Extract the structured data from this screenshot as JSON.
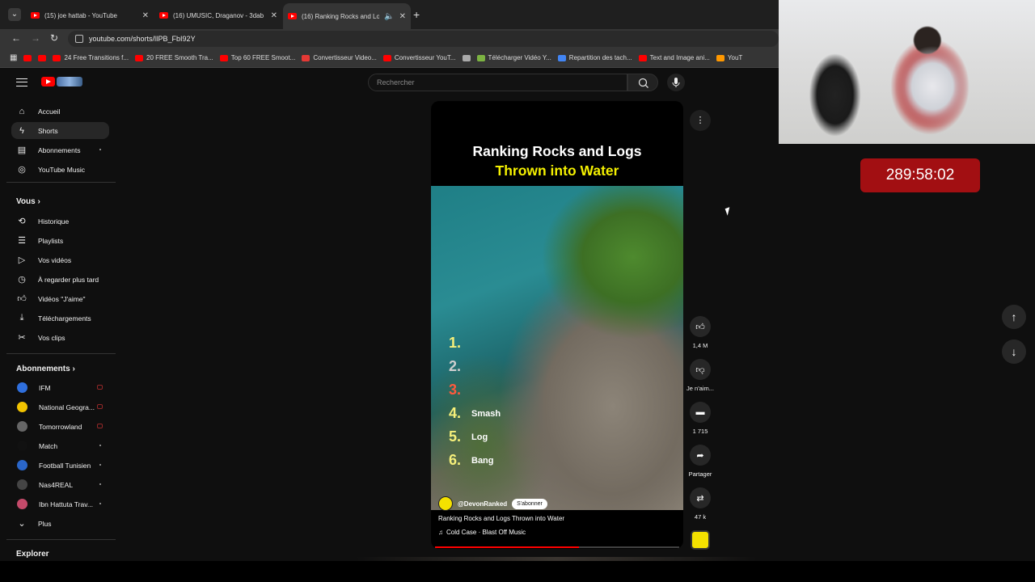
{
  "browser": {
    "tabs": [
      {
        "title": "(15) joe hattab - YouTube",
        "active": false
      },
      {
        "title": "(16) UMUSIC, Draganov - 3dab",
        "active": false
      },
      {
        "title": "(16) Ranking Rocks and Log",
        "active": true
      }
    ],
    "url": "youtube.com/shorts/lIPB_FbI92Y",
    "bookmarks": [
      {
        "label": "",
        "icon": "youtube-icon",
        "color": "#ff0000"
      },
      {
        "label": "",
        "icon": "youtube-icon",
        "color": "#ff0000"
      },
      {
        "label": "24 Free Transitions f...",
        "icon": "youtube-icon",
        "color": "#ff0000"
      },
      {
        "label": "20 FREE Smooth Tra...",
        "icon": "youtube-icon",
        "color": "#ff0000"
      },
      {
        "label": "Top 60 FREE Smoot...",
        "icon": "youtube-icon",
        "color": "#ff0000"
      },
      {
        "label": "Convertisseur Video...",
        "icon": "z-icon",
        "color": "#e53935"
      },
      {
        "label": "Convertisseur YouT...",
        "icon": "youtube-icon",
        "color": "#ff0000"
      },
      {
        "label": "",
        "icon": "globe-icon",
        "color": "#aaaaaa"
      },
      {
        "label": "Télécharger Vidéo Y...",
        "icon": "download-icon",
        "color": "#7cb342"
      },
      {
        "label": "Repartition des tach...",
        "icon": "docs-icon",
        "color": "#4285f4"
      },
      {
        "label": "Text and Image ani...",
        "icon": "youtube-icon",
        "color": "#ff0000"
      },
      {
        "label": "YouT",
        "icon": "hash-icon",
        "color": "#ff9800"
      }
    ]
  },
  "sidebar": {
    "main": [
      {
        "label": "Accueil",
        "icon": "home-icon"
      },
      {
        "label": "Shorts",
        "icon": "shorts-icon",
        "active": true
      },
      {
        "label": "Abonnements",
        "icon": "subscriptions-icon",
        "dot": true
      },
      {
        "label": "YouTube Music",
        "icon": "music-icon"
      }
    ],
    "you_heading": "Vous",
    "you": [
      {
        "label": "Historique",
        "icon": "history-icon"
      },
      {
        "label": "Playlists",
        "icon": "playlist-icon"
      },
      {
        "label": "Vos vidéos",
        "icon": "video-icon"
      },
      {
        "label": "À regarder plus tard",
        "icon": "clock-icon"
      },
      {
        "label": "Vidéos \"J'aime\"",
        "icon": "thumb-up-icon"
      },
      {
        "label": "Téléchargements",
        "icon": "download-icon"
      },
      {
        "label": "Vos clips",
        "icon": "scissors-icon"
      }
    ],
    "subs_heading": "Abonnements",
    "subscriptions": [
      {
        "label": "IFM",
        "color": "#2f6fdd",
        "live": true
      },
      {
        "label": "National Geogra...",
        "color": "#f2c300",
        "live": true
      },
      {
        "label": "Tomorrowland",
        "color": "#666666",
        "live": true
      },
      {
        "label": "Match",
        "color": "#111111",
        "dot": true
      },
      {
        "label": "Football Tunisien",
        "color": "#2a66c9",
        "dot": true
      },
      {
        "label": "Nas4REAL",
        "color": "#444444",
        "dot": true
      },
      {
        "label": "Ibn Hattuta Trav...",
        "color": "#c44a6a",
        "dot": true
      },
      {
        "label": "Plus",
        "icon": "chevron-down-icon"
      }
    ],
    "explore_heading": "Explorer"
  },
  "search": {
    "placeholder": "Rechercher"
  },
  "short": {
    "title_line1": "Ranking Rocks and Logs",
    "title_line2": "Thrown into Water",
    "ranking": [
      {
        "num": "1.",
        "name": ""
      },
      {
        "num": "2.",
        "name": ""
      },
      {
        "num": "3.",
        "name": ""
      },
      {
        "num": "4.",
        "name": "Smash"
      },
      {
        "num": "5.",
        "name": "Log"
      },
      {
        "num": "6.",
        "name": "Bang"
      }
    ],
    "channel": "@DevonRanked",
    "subscribe_label": "S'abonner",
    "caption": "Ranking Rocks and Logs Thrown into Water",
    "music": "Cold Case · Blast Off Music",
    "progress": 0.59
  },
  "actions": {
    "likes": "1,4 M",
    "dislike_label": "Je n'aim...",
    "comments": "1 715",
    "share_label": "Partager",
    "remix_count": "47 k"
  },
  "timer": "289:58:02"
}
